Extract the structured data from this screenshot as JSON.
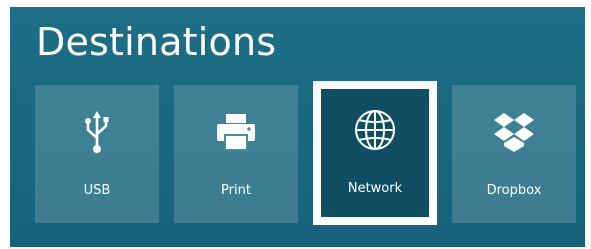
{
  "panel": {
    "title": "Destinations",
    "selected": "Network",
    "tiles": [
      {
        "label": "USB",
        "icon": "usb-icon"
      },
      {
        "label": "Print",
        "icon": "printer-icon"
      },
      {
        "label": "Network",
        "icon": "globe-icon"
      },
      {
        "label": "Dropbox",
        "icon": "dropbox-icon"
      }
    ]
  },
  "colors": {
    "panel_background": "#1a6880",
    "tile_background": "#4a8da2",
    "selected_tile_background": "#0f4e63",
    "selected_border": "#ffffff",
    "text": "#ffffff"
  }
}
